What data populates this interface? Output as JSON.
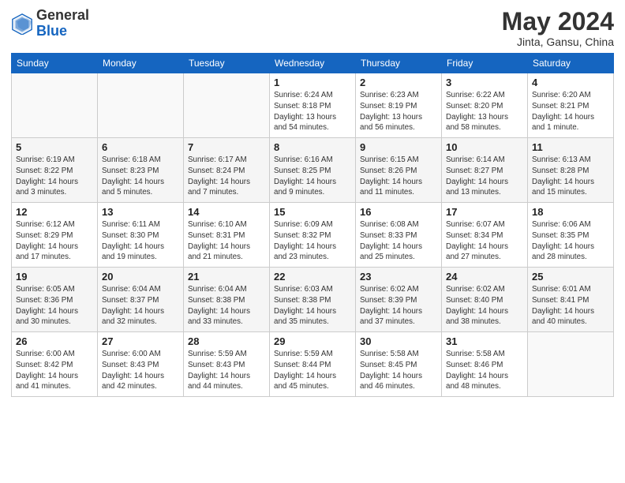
{
  "header": {
    "logo_general": "General",
    "logo_blue": "Blue",
    "month_title": "May 2024",
    "location": "Jinta, Gansu, China"
  },
  "weekdays": [
    "Sunday",
    "Monday",
    "Tuesday",
    "Wednesday",
    "Thursday",
    "Friday",
    "Saturday"
  ],
  "weeks": [
    [
      {
        "day": "",
        "info": ""
      },
      {
        "day": "",
        "info": ""
      },
      {
        "day": "",
        "info": ""
      },
      {
        "day": "1",
        "info": "Sunrise: 6:24 AM\nSunset: 8:18 PM\nDaylight: 13 hours\nand 54 minutes."
      },
      {
        "day": "2",
        "info": "Sunrise: 6:23 AM\nSunset: 8:19 PM\nDaylight: 13 hours\nand 56 minutes."
      },
      {
        "day": "3",
        "info": "Sunrise: 6:22 AM\nSunset: 8:20 PM\nDaylight: 13 hours\nand 58 minutes."
      },
      {
        "day": "4",
        "info": "Sunrise: 6:20 AM\nSunset: 8:21 PM\nDaylight: 14 hours\nand 1 minute."
      }
    ],
    [
      {
        "day": "5",
        "info": "Sunrise: 6:19 AM\nSunset: 8:22 PM\nDaylight: 14 hours\nand 3 minutes."
      },
      {
        "day": "6",
        "info": "Sunrise: 6:18 AM\nSunset: 8:23 PM\nDaylight: 14 hours\nand 5 minutes."
      },
      {
        "day": "7",
        "info": "Sunrise: 6:17 AM\nSunset: 8:24 PM\nDaylight: 14 hours\nand 7 minutes."
      },
      {
        "day": "8",
        "info": "Sunrise: 6:16 AM\nSunset: 8:25 PM\nDaylight: 14 hours\nand 9 minutes."
      },
      {
        "day": "9",
        "info": "Sunrise: 6:15 AM\nSunset: 8:26 PM\nDaylight: 14 hours\nand 11 minutes."
      },
      {
        "day": "10",
        "info": "Sunrise: 6:14 AM\nSunset: 8:27 PM\nDaylight: 14 hours\nand 13 minutes."
      },
      {
        "day": "11",
        "info": "Sunrise: 6:13 AM\nSunset: 8:28 PM\nDaylight: 14 hours\nand 15 minutes."
      }
    ],
    [
      {
        "day": "12",
        "info": "Sunrise: 6:12 AM\nSunset: 8:29 PM\nDaylight: 14 hours\nand 17 minutes."
      },
      {
        "day": "13",
        "info": "Sunrise: 6:11 AM\nSunset: 8:30 PM\nDaylight: 14 hours\nand 19 minutes."
      },
      {
        "day": "14",
        "info": "Sunrise: 6:10 AM\nSunset: 8:31 PM\nDaylight: 14 hours\nand 21 minutes."
      },
      {
        "day": "15",
        "info": "Sunrise: 6:09 AM\nSunset: 8:32 PM\nDaylight: 14 hours\nand 23 minutes."
      },
      {
        "day": "16",
        "info": "Sunrise: 6:08 AM\nSunset: 8:33 PM\nDaylight: 14 hours\nand 25 minutes."
      },
      {
        "day": "17",
        "info": "Sunrise: 6:07 AM\nSunset: 8:34 PM\nDaylight: 14 hours\nand 27 minutes."
      },
      {
        "day": "18",
        "info": "Sunrise: 6:06 AM\nSunset: 8:35 PM\nDaylight: 14 hours\nand 28 minutes."
      }
    ],
    [
      {
        "day": "19",
        "info": "Sunrise: 6:05 AM\nSunset: 8:36 PM\nDaylight: 14 hours\nand 30 minutes."
      },
      {
        "day": "20",
        "info": "Sunrise: 6:04 AM\nSunset: 8:37 PM\nDaylight: 14 hours\nand 32 minutes."
      },
      {
        "day": "21",
        "info": "Sunrise: 6:04 AM\nSunset: 8:38 PM\nDaylight: 14 hours\nand 33 minutes."
      },
      {
        "day": "22",
        "info": "Sunrise: 6:03 AM\nSunset: 8:38 PM\nDaylight: 14 hours\nand 35 minutes."
      },
      {
        "day": "23",
        "info": "Sunrise: 6:02 AM\nSunset: 8:39 PM\nDaylight: 14 hours\nand 37 minutes."
      },
      {
        "day": "24",
        "info": "Sunrise: 6:02 AM\nSunset: 8:40 PM\nDaylight: 14 hours\nand 38 minutes."
      },
      {
        "day": "25",
        "info": "Sunrise: 6:01 AM\nSunset: 8:41 PM\nDaylight: 14 hours\nand 40 minutes."
      }
    ],
    [
      {
        "day": "26",
        "info": "Sunrise: 6:00 AM\nSunset: 8:42 PM\nDaylight: 14 hours\nand 41 minutes."
      },
      {
        "day": "27",
        "info": "Sunrise: 6:00 AM\nSunset: 8:43 PM\nDaylight: 14 hours\nand 42 minutes."
      },
      {
        "day": "28",
        "info": "Sunrise: 5:59 AM\nSunset: 8:43 PM\nDaylight: 14 hours\nand 44 minutes."
      },
      {
        "day": "29",
        "info": "Sunrise: 5:59 AM\nSunset: 8:44 PM\nDaylight: 14 hours\nand 45 minutes."
      },
      {
        "day": "30",
        "info": "Sunrise: 5:58 AM\nSunset: 8:45 PM\nDaylight: 14 hours\nand 46 minutes."
      },
      {
        "day": "31",
        "info": "Sunrise: 5:58 AM\nSunset: 8:46 PM\nDaylight: 14 hours\nand 48 minutes."
      },
      {
        "day": "",
        "info": ""
      }
    ]
  ]
}
